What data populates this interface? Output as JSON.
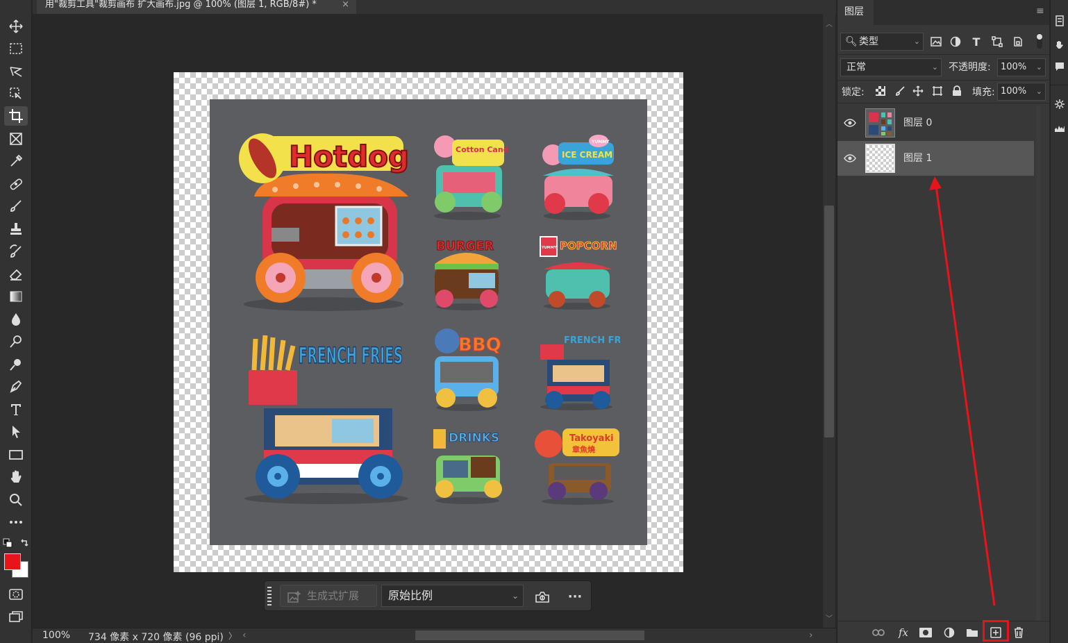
{
  "document": {
    "tab_title": "用\"裁剪工具\"裁剪画布 扩大画布.jpg @ 100% (图层 1, RGB/8#) *",
    "tab_close": "×"
  },
  "status": {
    "zoom": "100%",
    "info": "734 像素 x 720 像素 (96 ppi)",
    "arrow_right": "〉",
    "scroll_left": "‹",
    "scroll_right": "›"
  },
  "context_bar": {
    "generative_expand_label": "生成式扩展",
    "ratio_value": "原始比例",
    "more_label": "···"
  },
  "panel": {
    "tab_label": "图层",
    "menu_glyph": "≡",
    "filter_kind": "类型",
    "blend_mode": "正常",
    "opacity_label": "不透明度:",
    "opacity_value": "100%",
    "lock_label": "锁定:",
    "fill_label": "填充:",
    "fill_value": "100%",
    "layers": [
      {
        "name": "图层 0",
        "selected": false
      },
      {
        "name": "图层 1",
        "selected": true
      }
    ]
  },
  "artwork": {
    "signs": [
      "Hotdog",
      "Cotton Candy",
      "ICE CREAM",
      "BURGER",
      "POPCORN",
      "FRENCH FRIES",
      "BBQ",
      "FRENCH FRIES",
      "DRINKS",
      "Takoyaki"
    ],
    "small_badges": [
      "YUMMY",
      "YUMMY",
      "章魚燒"
    ]
  },
  "colors": {
    "highlight_red": "#e8141a",
    "foreground_swatch": "#e8141a",
    "background_swatch": "#ffffff",
    "artwork_bg": "#5c5d60"
  }
}
